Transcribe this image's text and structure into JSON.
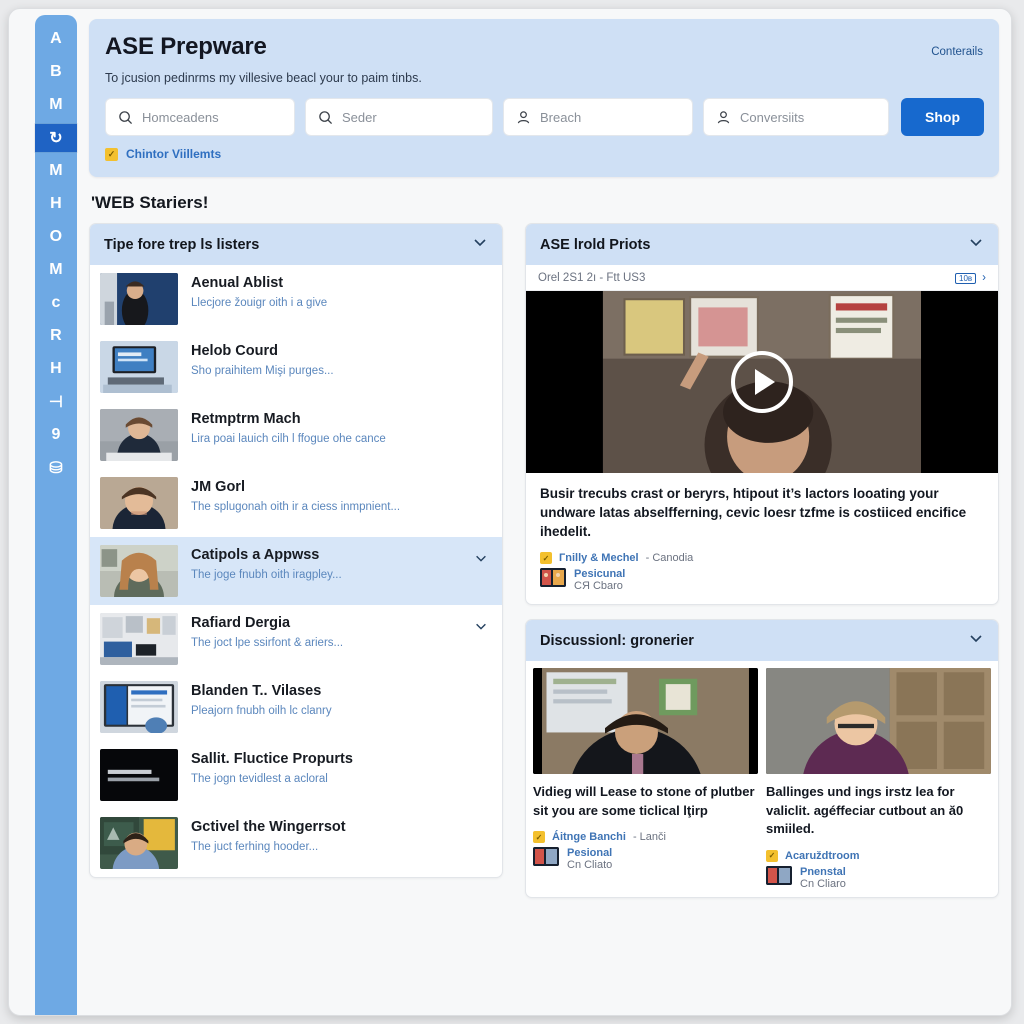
{
  "sidebar": {
    "items": [
      {
        "label": "A",
        "name": "sidebar-item-a",
        "active": false
      },
      {
        "label": "B",
        "name": "sidebar-item-b",
        "active": false
      },
      {
        "label": "M",
        "name": "sidebar-item-m1",
        "active": false
      },
      {
        "label": "↻",
        "name": "sidebar-item-refresh",
        "active": true
      },
      {
        "label": "M",
        "name": "sidebar-item-m2",
        "active": false
      },
      {
        "label": "H",
        "name": "sidebar-item-h1",
        "active": false
      },
      {
        "label": "O",
        "name": "sidebar-item-o",
        "active": false
      },
      {
        "label": "M",
        "name": "sidebar-item-m3",
        "active": false
      },
      {
        "label": "с",
        "name": "sidebar-item-c",
        "active": false
      },
      {
        "label": "R",
        "name": "sidebar-item-r",
        "active": false
      },
      {
        "label": "H",
        "name": "sidebar-item-h2",
        "active": false
      },
      {
        "label": "⊣",
        "name": "sidebar-item-bracket",
        "active": false
      },
      {
        "label": "9",
        "name": "sidebar-item-9",
        "active": false
      },
      {
        "label": "⛁",
        "name": "sidebar-item-briefcase",
        "active": false
      }
    ]
  },
  "hero": {
    "title": "ASE Prepware",
    "subtitle": "To jcusion pedinrms my villesive beacl your to paim tinbs.",
    "top_link": "Conterails",
    "fields": [
      {
        "placeholder": "Homceadens",
        "icon": "search-icon"
      },
      {
        "placeholder": "Seder",
        "icon": "search-icon"
      },
      {
        "placeholder": "Breach",
        "icon": "person-icon"
      },
      {
        "placeholder": "Conversiits",
        "icon": "person-icon"
      }
    ],
    "shop_label": "Shop",
    "checkbox_label": "Chintor Viillemts",
    "checkbox_mark": "✓",
    "accent_blue": "#1769ce",
    "band_blue": "#cfe0f5",
    "check_yellow": "#f3c02e"
  },
  "section_title": "'WEB Stariers!",
  "left_panel": {
    "header": "Tipe fore trep ls listers",
    "rows": [
      {
        "title": "Aenual Ablist",
        "desc": "Llecjore žouigr oith i a give",
        "chevron": false,
        "selected": false,
        "thumb": "speaker-stage"
      },
      {
        "title": "Helob Courd",
        "desc": "Sho praihitem Mişi purges...",
        "chevron": false,
        "selected": false,
        "thumb": "monitor-desk"
      },
      {
        "title": "Retmptrm Mach",
        "desc": "Lira poai lauich cilh l ffogue ohe cance",
        "chevron": false,
        "selected": false,
        "thumb": "student-desk"
      },
      {
        "title": "JM Gorl",
        "desc": "The spluɡonah oith ir a ciess inmpnient...",
        "chevron": false,
        "selected": false,
        "thumb": "young-man"
      },
      {
        "title": "Catipols a Appwss",
        "desc": "The joge fnubh oith iragpley...",
        "chevron": true,
        "selected": true,
        "thumb": "woman-office"
      },
      {
        "title": "Rafiard Dergia",
        "desc": "The joct lpe ssirfont & ariers...",
        "chevron": true,
        "selected": false,
        "thumb": "workspace"
      },
      {
        "title": "Blanden T.. Vilases",
        "desc": "Pleajorn fnubh oilh lc clanry",
        "chevron": false,
        "selected": false,
        "thumb": "tablet-ui"
      },
      {
        "title": "Sallit. Fluctice Propurts",
        "desc": "The jogn tevidlest a acloral",
        "chevron": false,
        "selected": false,
        "thumb": "black-title"
      },
      {
        "title": "Gctivel the Wingerrsot",
        "desc": "The juct ferhing hooder...",
        "chevron": false,
        "selected": false,
        "thumb": "classroom-man"
      }
    ]
  },
  "video_panel": {
    "header": "ASE lrold Priots",
    "meta_left": "Orel 2S1 2ı - Ftt US3",
    "meta_badge": "10в",
    "meta_arrow": "›",
    "caption": "Busir trecubs crast or beryrs, htipout it’s lactors looating your undware latas abselfferning, cevic loesr tzfme is costiiced encifice ihedelit.",
    "byline_name": "Гnilly & Mechel",
    "byline_sep": "- Canodia",
    "byline_line1": "Pesicunal",
    "byline_line2": "CЯ Cbaro"
  },
  "discussion_panel": {
    "header": "Discussionl: gronerier",
    "items": [
      {
        "caption": "Vidieg will Lease to stone of plutber sit you are some ticlical lţirp",
        "byline_name": "Áitnge Banchi",
        "byline_sep": "- Lanči",
        "byline_line1": "Pesional",
        "byline_line2": "Cn Cliato",
        "thumb": "man-office"
      },
      {
        "caption": "Ballinges und ings irstz lea for valiclit. agéffeciar cutbout an ă0 smiiled.",
        "byline_name": "Acaruždtroom",
        "byline_sep": "",
        "byline_line1": "Pnenstal",
        "byline_line2": "Cn Cliaro",
        "thumb": "woman-shelf"
      }
    ]
  }
}
